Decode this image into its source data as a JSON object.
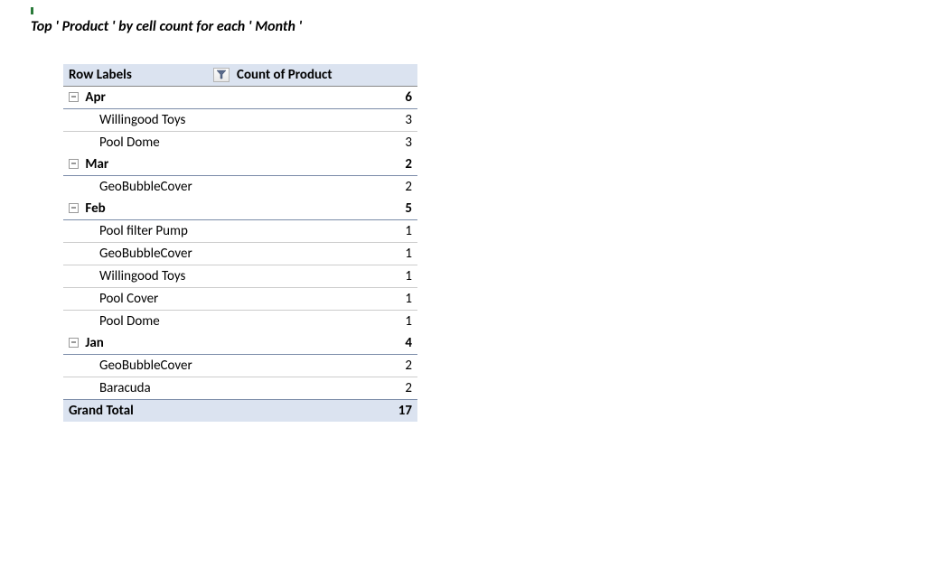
{
  "title": "Top ' Product ' by cell count for each ' Month '",
  "headers": {
    "row_labels": "Row Labels",
    "count_label": "Count of  Product"
  },
  "groups": [
    {
      "month": "Apr",
      "subtotal": "6",
      "items": [
        {
          "name": "Willingood Toys",
          "count": "3"
        },
        {
          "name": "Pool Dome",
          "count": "3"
        }
      ]
    },
    {
      "month": "Mar",
      "subtotal": "2",
      "items": [
        {
          "name": "GeoBubbleCover",
          "count": "2"
        }
      ]
    },
    {
      "month": "Feb",
      "subtotal": "5",
      "items": [
        {
          "name": "Pool filter Pump",
          "count": "1"
        },
        {
          "name": "GeoBubbleCover",
          "count": "1"
        },
        {
          "name": "Willingood Toys",
          "count": "1"
        },
        {
          "name": "Pool Cover",
          "count": "1"
        },
        {
          "name": "Pool Dome",
          "count": "1"
        }
      ]
    },
    {
      "month": "Jan",
      "subtotal": "4",
      "items": [
        {
          "name": "GeoBubbleCover",
          "count": "2"
        },
        {
          "name": "Baracuda",
          "count": "2"
        }
      ]
    }
  ],
  "grand_total": {
    "label": "Grand Total",
    "value": "17"
  }
}
